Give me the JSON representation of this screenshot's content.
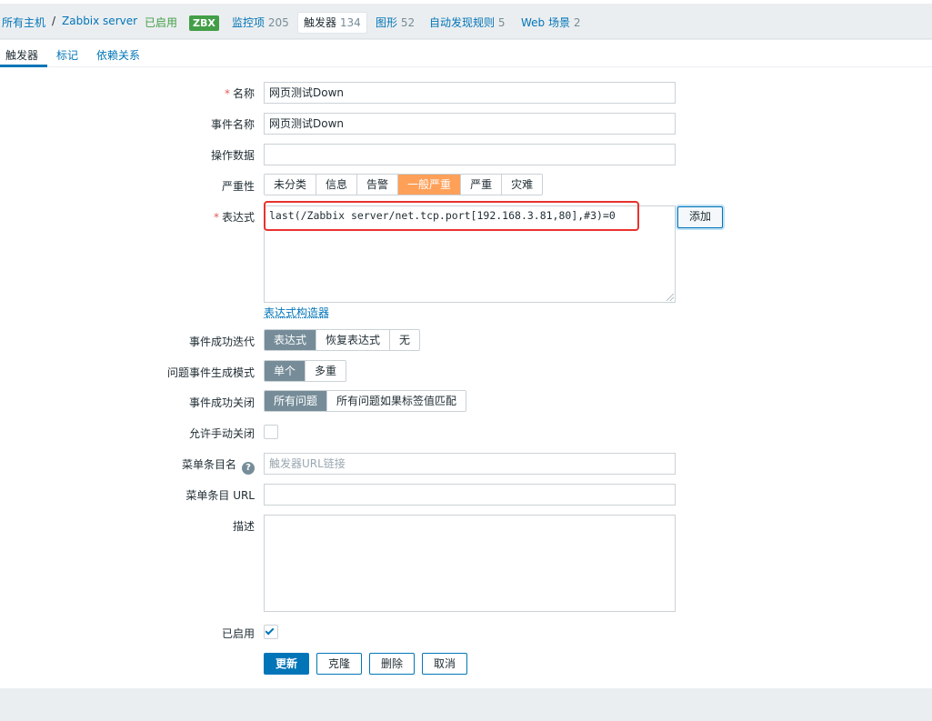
{
  "breadcrumb": {
    "all_hosts": "所有主机",
    "separator": "/",
    "host": "Zabbix server",
    "status": "已启用",
    "badge": "ZBX",
    "items_label": "监控项",
    "items_count": "205",
    "triggers_label": "触发器",
    "triggers_count": "134",
    "graphs_label": "图形",
    "graphs_count": "52",
    "discovery_label": "自动发现规则",
    "discovery_count": "5",
    "web_label": "Web 场景",
    "web_count": "2"
  },
  "tabs": {
    "trigger": "触发器",
    "tags": "标记",
    "dependencies": "依赖关系"
  },
  "form": {
    "required_mark": "*",
    "name_label": "名称",
    "name_value": "网页测试Down",
    "event_name_label": "事件名称",
    "event_name_value": "网页测试Down",
    "opdata_label": "操作数据",
    "opdata_value": "",
    "severity_label": "严重性",
    "severity_options": [
      "未分类",
      "信息",
      "告警",
      "一般严重",
      "严重",
      "灾难"
    ],
    "severity_selected": "一般严重",
    "expression_label": "表达式",
    "expression_value": "last(/Zabbix server/net.tcp.port[192.168.3.81,80],#3)=0",
    "add_button": "添加",
    "expression_builder": "表达式构造器",
    "ok_event_gen_label": "事件成功迭代",
    "ok_event_gen_options": [
      "表达式",
      "恢复表达式",
      "无"
    ],
    "ok_event_gen_selected": "表达式",
    "problem_mode_label": "问题事件生成模式",
    "problem_mode_options": [
      "单个",
      "多重"
    ],
    "problem_mode_selected": "单个",
    "ok_close_label": "事件成功关闭",
    "ok_close_options": [
      "所有问题",
      "所有问题如果标签值匹配"
    ],
    "ok_close_selected": "所有问题",
    "manual_close_label": "允许手动关闭",
    "manual_close_checked": false,
    "menu_name_label": "菜单条目名",
    "help_glyph": "?",
    "menu_name_placeholder": "触发器URL链接",
    "menu_url_label": "菜单条目 URL",
    "menu_url_value": "",
    "description_label": "描述",
    "description_value": "",
    "enabled_label": "已启用",
    "enabled_checked": true
  },
  "actions": {
    "update": "更新",
    "clone": "克隆",
    "delete": "删除",
    "cancel": "取消"
  },
  "colors": {
    "accent": "#0275b8",
    "enabled_green": "#429e47",
    "severity_average": "#ffa059",
    "highlight_red": "#e8322e"
  }
}
